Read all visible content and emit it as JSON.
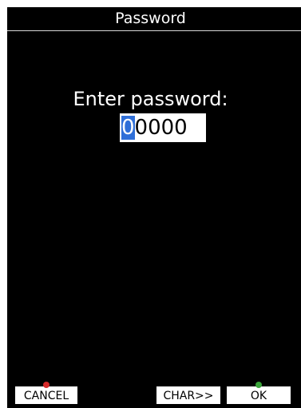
{
  "title": "Password",
  "prompt": "Enter password:",
  "password": {
    "cursor_char": "0",
    "rest": "0000"
  },
  "buttons": {
    "cancel": "CANCEL",
    "char": "CHAR>>",
    "ok": "OK"
  },
  "colors": {
    "background": "#000000",
    "cursor_highlight": "#2f6fd8",
    "cancel_badge": "#d62a2a",
    "ok_badge": "#3aa43a"
  }
}
